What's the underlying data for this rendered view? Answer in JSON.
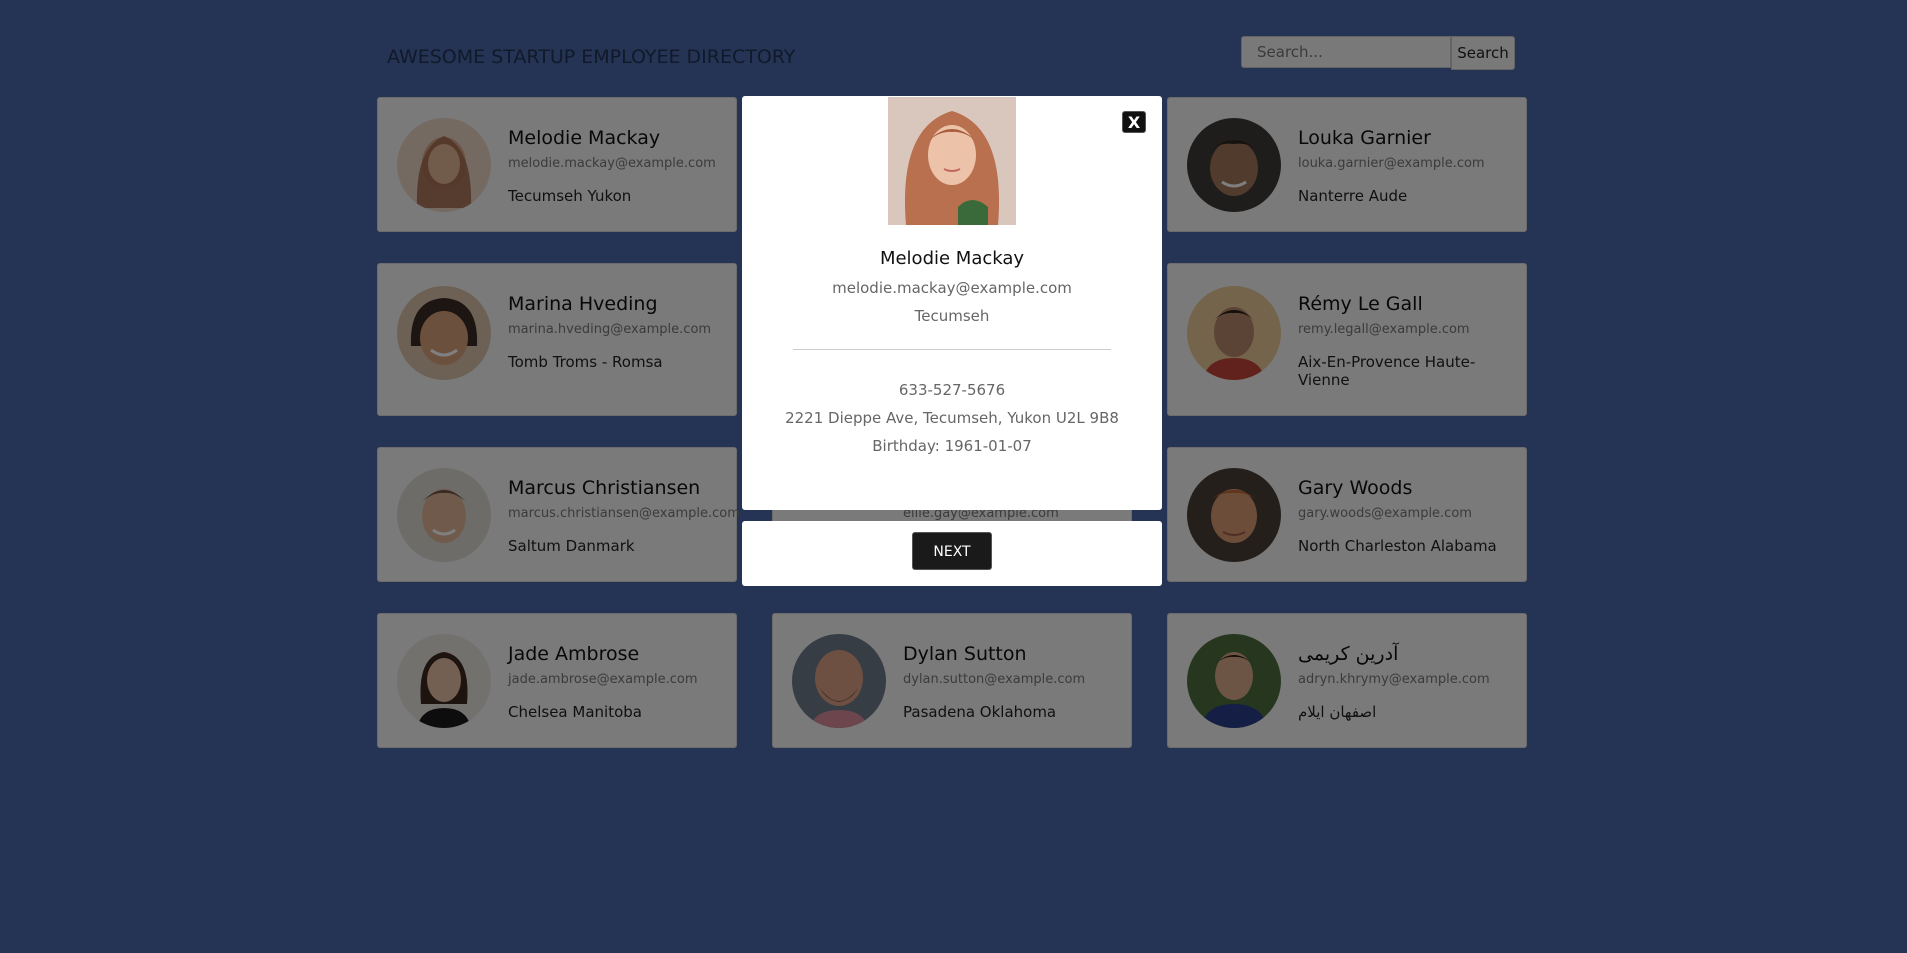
{
  "header": {
    "title": "AWESOME STARTUP EMPLOYEE DIRECTORY",
    "search_placeholder": "Search...",
    "search_button": "Search"
  },
  "employees": [
    {
      "name": "Melodie Mackay",
      "email": "melodie.mackay@example.com",
      "location": "Tecumseh Yukon",
      "avatar_color": "#c98b6e"
    },
    {
      "name": "Louka Garnier",
      "email": "louka.garnier@example.com",
      "location": "Nanterre Aude",
      "avatar_color": "#6b5a4a"
    },
    {
      "name": "Marina Hveding",
      "email": "marina.hveding@example.com",
      "location": "Tomb Troms - Romsa",
      "avatar_color": "#b27a5e"
    },
    {
      "name": "Rémy Le Gall",
      "email": "remy.legall@example.com",
      "location": "Aix-En-Provence Haute-Vienne",
      "avatar_color": "#c49a72"
    },
    {
      "name": "Marcus Christiansen",
      "email": "marcus.christiansen@example.com",
      "location": "Saltum Danmark",
      "avatar_color": "#a58a6e"
    },
    {
      "name": "Gary Woods",
      "email": "gary.woods@example.com",
      "location": "North Charleston Alabama",
      "avatar_color": "#b86a45"
    },
    {
      "name": "Jade Ambrose",
      "email": "jade.ambrose@example.com",
      "location": "Chelsea Manitoba",
      "avatar_color": "#8a6a5a"
    },
    {
      "name": "Dylan Sutton",
      "email": "dylan.sutton@example.com",
      "location": "Pasadena Oklahoma",
      "avatar_color": "#a07a62"
    },
    {
      "name": "آدرین کریمی",
      "email": "adryn.khrymy@example.com",
      "location": "اصفهان ایلام",
      "avatar_color": "#4a6a4a"
    }
  ],
  "partial_card": {
    "email": "ellie.gay@example.com"
  },
  "modal": {
    "close_label": "X",
    "name": "Melodie Mackay",
    "email": "melodie.mackay@example.com",
    "city": "Tecumseh",
    "phone": "633-527-5676",
    "address": "2221 Dieppe Ave, Tecumseh, Yukon U2L 9B8",
    "birthday": "Birthday: 1961-01-07",
    "next_label": "NEXT"
  },
  "colors": {
    "background": "#4a67a8",
    "card": "#f4f4f4",
    "overlay": "rgba(0,0,0,0.5)"
  }
}
